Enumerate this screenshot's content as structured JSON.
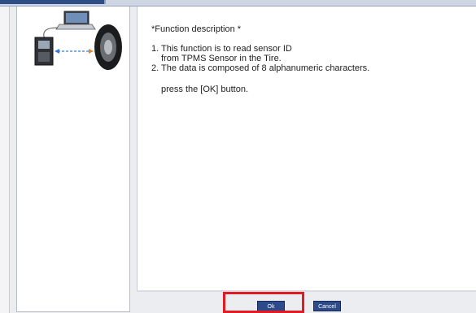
{
  "description": {
    "title": "*Function description *",
    "lines": [
      "1. This function is to read sensor ID",
      "from TPMS Sensor in the Tire.",
      "2. The data is composed of 8 alphanumeric characters."
    ],
    "action": "press the [OK] button."
  },
  "buttons": {
    "ok": "Ok",
    "cancel": "Cancel"
  },
  "colors": {
    "button_bg": "#2d4a8a",
    "highlight": "#e01b24",
    "title_bar": "#2f4e86"
  },
  "illustration": {
    "icons": [
      "laptop-icon",
      "tpms-tool-icon",
      "tire-icon"
    ]
  }
}
